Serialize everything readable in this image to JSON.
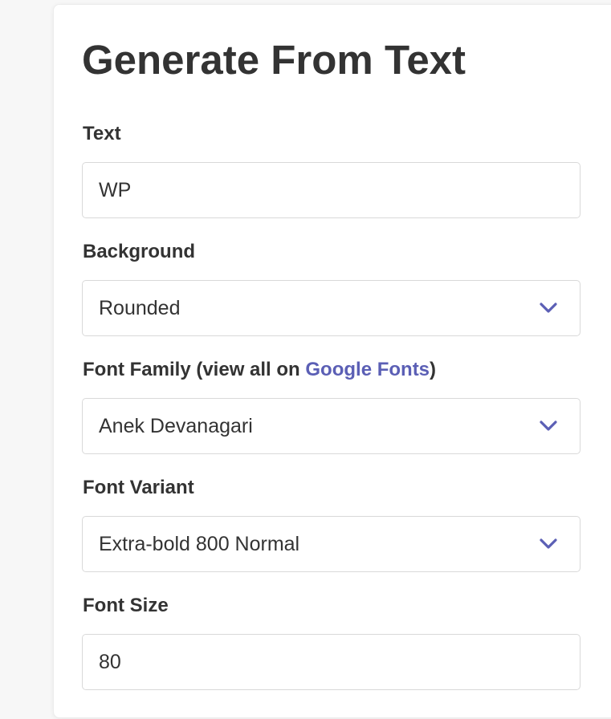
{
  "form": {
    "title": "Generate From Text",
    "text_label": "Text",
    "text_value": "WP",
    "background_label": "Background",
    "background_value": "Rounded",
    "font_family_label_prefix": "Font Family (view all on ",
    "font_family_link": "Google Fonts",
    "font_family_label_suffix": ")",
    "font_family_value": "Anek Devanagari",
    "font_variant_label": "Font Variant",
    "font_variant_value": "Extra-bold 800 Normal",
    "font_size_label": "Font Size",
    "font_size_value": "80"
  },
  "colors": {
    "accent": "#5b5fb5",
    "text": "#333333",
    "border": "#d9d9d9"
  },
  "icons": {
    "dropdown": "chevron-down-icon"
  }
}
